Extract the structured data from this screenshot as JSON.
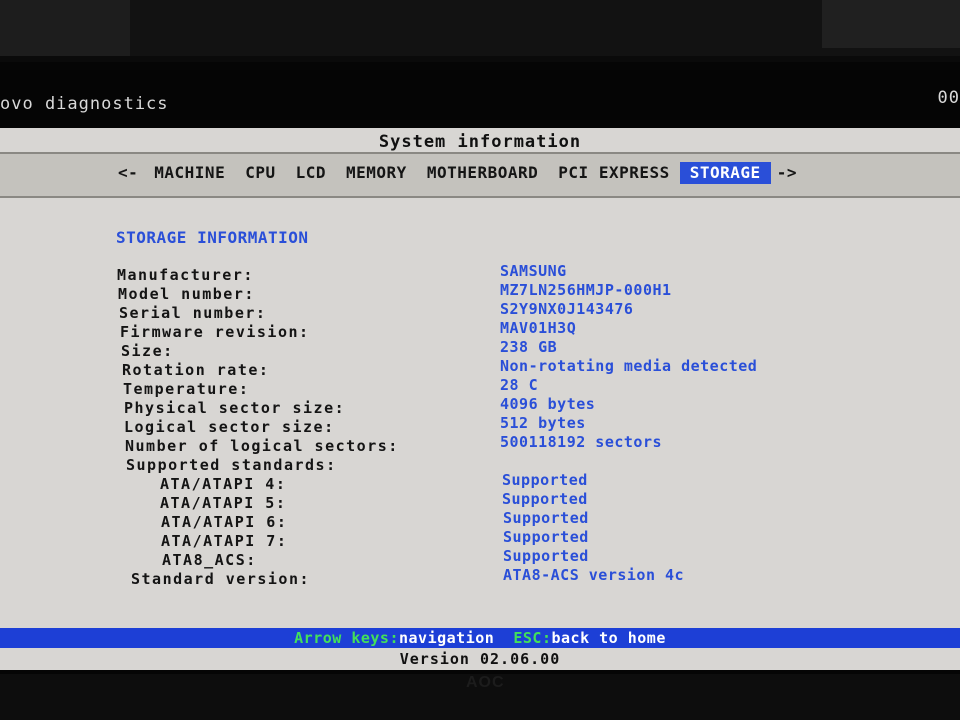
{
  "app_title": "ovo diagnostics",
  "clock": "00",
  "window_title": "System information",
  "tabs": [
    {
      "label": "<-"
    },
    {
      "label": "MACHINE"
    },
    {
      "label": "CPU"
    },
    {
      "label": "LCD"
    },
    {
      "label": "MEMORY"
    },
    {
      "label": "MOTHERBOARD"
    },
    {
      "label": "PCI EXPRESS"
    },
    {
      "label": "STORAGE",
      "active": true
    },
    {
      "label": "->"
    }
  ],
  "section_title": "STORAGE INFORMATION",
  "info": {
    "manufacturer": {
      "label": "Manufacturer:",
      "value": "SAMSUNG"
    },
    "model": {
      "label": "Model number:",
      "value": "MZ7LN256HMJP-000H1"
    },
    "serial": {
      "label": "Serial number:",
      "value": "S2Y9NX0J143476"
    },
    "firmware": {
      "label": "Firmware revision:",
      "value": "MAV01H3Q"
    },
    "size": {
      "label": "Size:",
      "value": "238 GB"
    },
    "rotation": {
      "label": "Rotation rate:",
      "value": "Non-rotating media detected"
    },
    "temperature": {
      "label": "Temperature:",
      "value": "28 C"
    },
    "physical_sector": {
      "label": "Physical sector size:",
      "value": "4096 bytes"
    },
    "logical_sector": {
      "label": "Logical sector size:",
      "value": "512 bytes"
    },
    "logical_sectors": {
      "label": "Number of logical sectors:",
      "value": "500118192 sectors"
    },
    "supported_standards": {
      "label": "Supported standards:"
    },
    "ata4": {
      "label": "ATA/ATAPI 4:",
      "value": "Supported"
    },
    "ata5": {
      "label": "ATA/ATAPI 5:",
      "value": "Supported"
    },
    "ata6": {
      "label": "ATA/ATAPI 6:",
      "value": "Supported"
    },
    "ata7": {
      "label": "ATA/ATAPI 7:",
      "value": "Supported"
    },
    "ata8": {
      "label": "ATA8_ACS:",
      "value": "Supported"
    },
    "standard_version": {
      "label": "Standard version:",
      "value": "ATA8-ACS version 4c"
    }
  },
  "statusbar": {
    "key1": "Arrow keys:",
    "desc1": "navigation",
    "key2": "ESC:",
    "desc2": "back to home"
  },
  "version": "Version 02.06.00",
  "monitor_brand": "AOC",
  "colors": {
    "accent": "#2a4fd8",
    "status_bar": "#1d3fd6",
    "key_green": "#43e05a",
    "window_bg": "#d8d6d3"
  }
}
